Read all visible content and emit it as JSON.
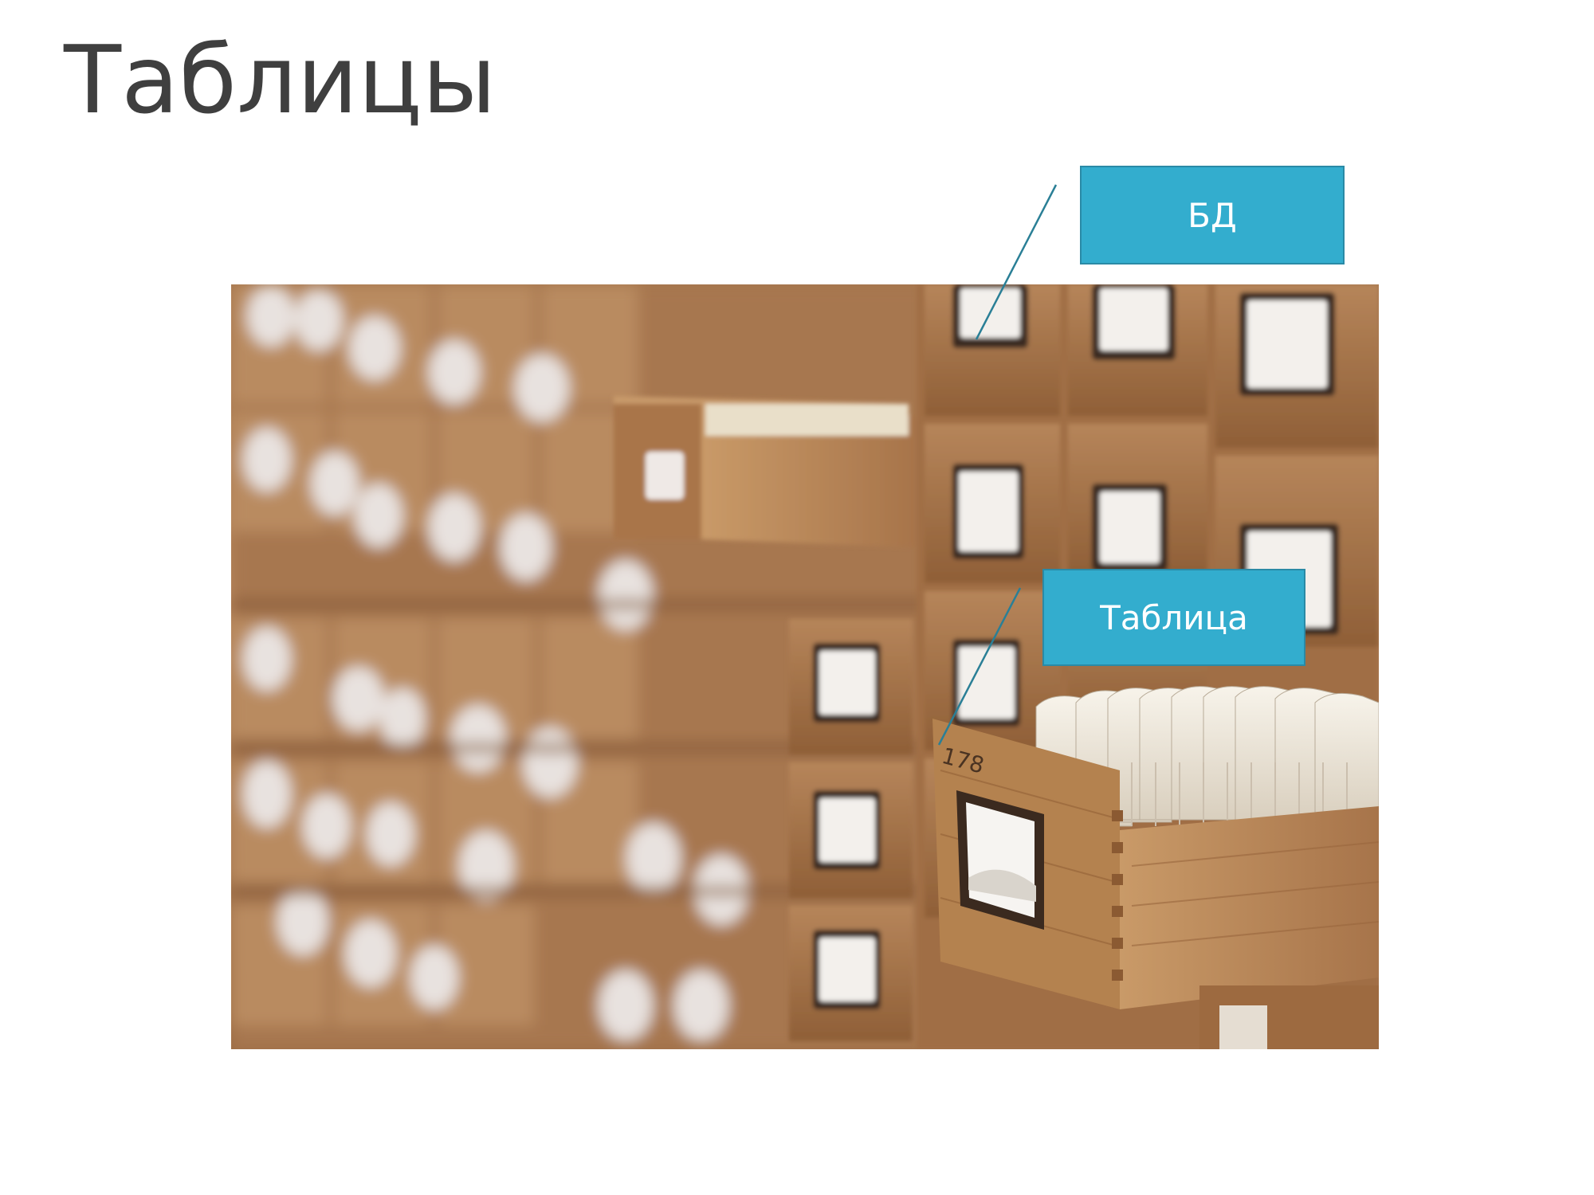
{
  "slide": {
    "title": "Таблицы"
  },
  "photo": {
    "subject": "card-catalog-drawers-photo"
  },
  "callouts": {
    "database_label": "БД",
    "table_label": "Таблица"
  },
  "colors": {
    "callout_fill": "#33adce",
    "callout_border": "#2a8aa6",
    "callout_line": "#2a7f96",
    "title_text": "#3f3f3f",
    "wood": "#a5764d"
  }
}
